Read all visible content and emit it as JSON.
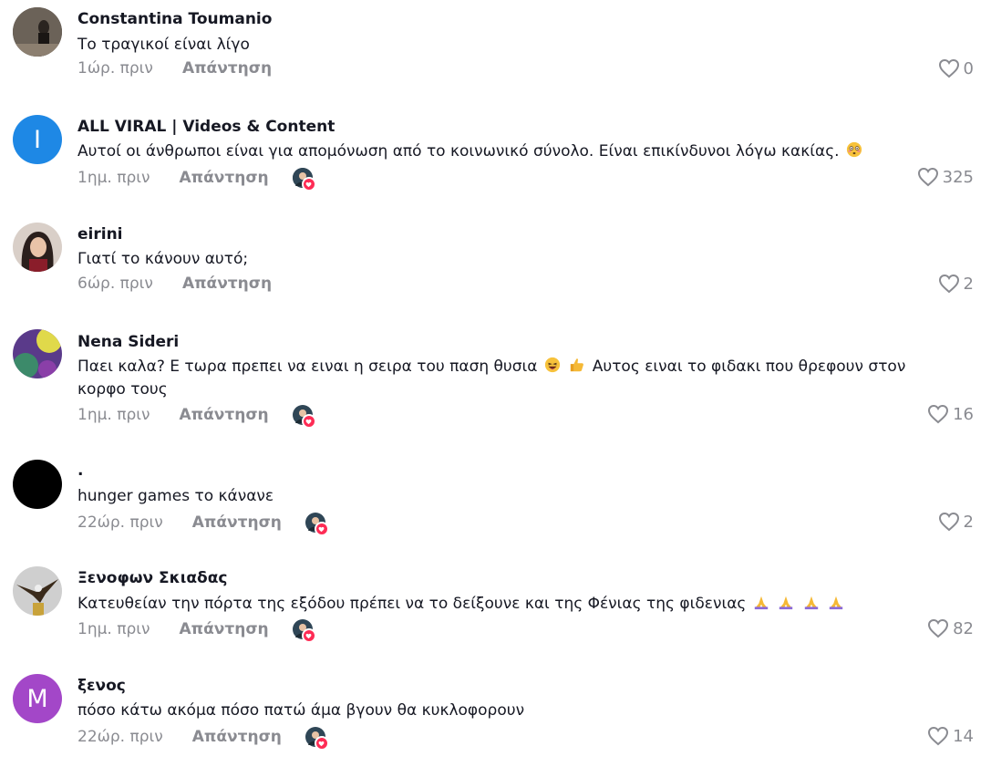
{
  "reply_label": "Απάντηση",
  "comments": [
    {
      "user": "Constantina Toumanio",
      "text": "Το τραγικοί είναι λίγο",
      "time": "1ώρ. πριν",
      "likes": "0",
      "creator_liked": false,
      "avatar_letter": ""
    },
    {
      "user": "ALL VIRAL | Videos & Content",
      "text": "Αυτοί οι άνθρωποι είναι για απομόνωση από το κοινωνικό σύνολο. Είναι επικίνδυνοι λόγω κακίας.",
      "time": "1ημ. πριν",
      "likes": "325",
      "creator_liked": true,
      "avatar_letter": "I"
    },
    {
      "user": "eirini",
      "text": "Γιατί το κάνουν αυτό;",
      "time": "6ώρ. πριν",
      "likes": "2",
      "creator_liked": false,
      "avatar_letter": ""
    },
    {
      "user": "Nena Sideri",
      "text_a": "Παει καλα? Ε τωρα πρεπει να ειναι η σειρα του παση θυσια",
      "text_b": "Αυτος ειναι το φιδακι που θρεφουν στον",
      "text_c": "κορφο τους",
      "time": "1ημ. πριν",
      "likes": "16",
      "creator_liked": true,
      "avatar_letter": ""
    },
    {
      "user": ".",
      "text": "hunger games το κάνανε",
      "time": "22ώρ. πριν",
      "likes": "2",
      "creator_liked": true,
      "avatar_letter": ""
    },
    {
      "user": "Ξενοφων Σκιαδας",
      "text": "Κατευθείαν την πόρτα της εξόδου πρέπει να το δείξουνε και της Φένιας της φιδενιας",
      "time": "1ημ. πριν",
      "likes": "82",
      "creator_liked": true,
      "avatar_letter": ""
    },
    {
      "user": "ξενος",
      "text": "πόσο κάτω ακόμα πόσο πατώ άμα βγουν θα κυκλοφορουν",
      "time": "22ώρ. πριν",
      "likes": "14",
      "creator_liked": true,
      "avatar_letter": "M"
    }
  ],
  "colors": {
    "avatar_viral": "#1e88e5",
    "avatar_m": "#a347c8",
    "heart_badge": "#fe2c55",
    "muted": "#8a8b91"
  }
}
